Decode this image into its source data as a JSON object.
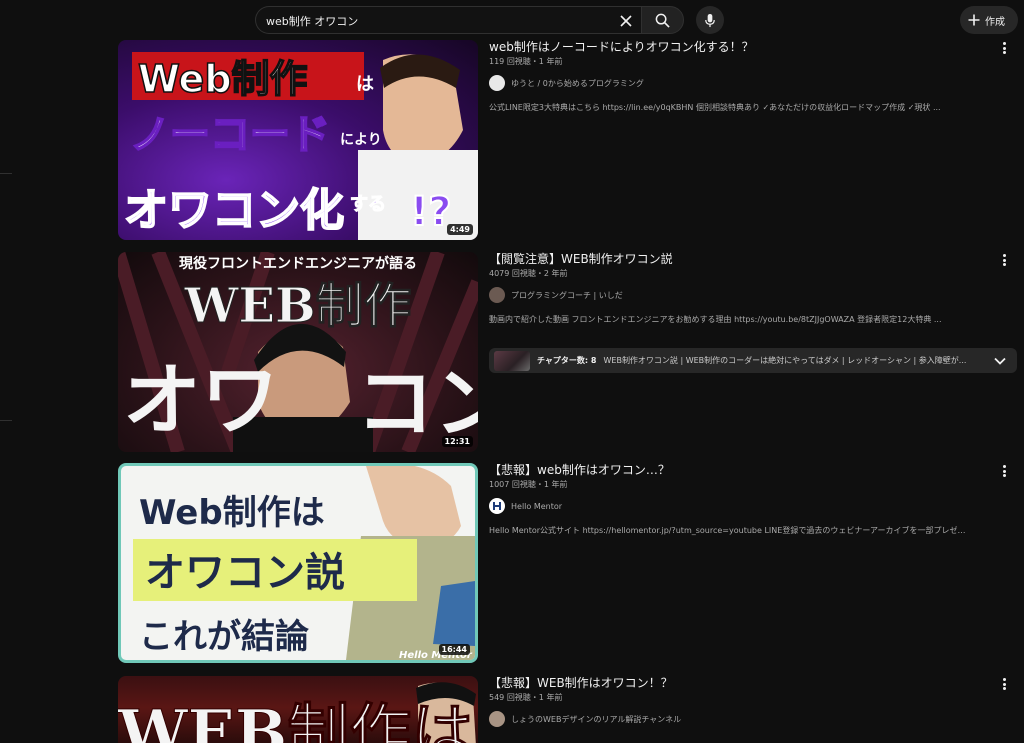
{
  "search": {
    "query": "web制作 オワコン"
  },
  "header": {
    "create_label": "作成"
  },
  "results": [
    {
      "title": "web制作はノーコードによりオワコン化する！？",
      "meta": "119 回視聴・1 年前",
      "channel": "ゆうと / 0から始めるプログラミング",
      "description": "公式LINE限定3大特典はこちら https://lin.ee/y0qKBHN 個別相談特典あり ✓あなただけの収益化ロードマップ作成 ✓現状 ...",
      "duration": "4:49",
      "thumb_text": [
        "Web制作",
        "は",
        "ノーコード",
        "により",
        "オワコン化",
        "する",
        "!?"
      ]
    },
    {
      "title": "【閲覧注意】WEB制作オワコン説",
      "meta": "4079 回視聴・2 年前",
      "channel": "プログラミングコーチ | いしだ",
      "description": "動画内で紹介した動画 フロントエンドエンジニアをお勧めする理由 https://youtu.be/8tZJJgOWAZA 登録者限定12大特典 ...",
      "duration": "12:31",
      "chapters_label": "チャプター数: 8",
      "chapters_text": "WEB制作オワコン説 | WEB制作のコーダーは絶対にやってはダメ | レッドオーシャン | 参入障壁が...",
      "thumb_text": [
        "現役フロントエンドエンジニアが語る",
        "WEB制作",
        "オワ",
        "コン"
      ]
    },
    {
      "title": "【悲報】web制作はオワコン…？",
      "meta": "1007 回視聴・1 年前",
      "channel": "Hello Mentor",
      "description": "Hello Mentor公式サイト https://hellomentor.jp/?utm_source=youtube LINE登録で過去のウェビナーアーカイブを一部プレゼント！",
      "duration": "16:44",
      "thumb_text": [
        "Web制作は",
        "オワコン説",
        "これが結論",
        "Hello Mentor"
      ]
    },
    {
      "title": "【悲報】WEB制作はオワコン！？",
      "meta": "549 回視聴・1 年前",
      "channel": "しょうのWEBデザインのリアル解説チャンネル",
      "thumb_text": [
        "WEB制作は"
      ]
    }
  ],
  "colors": {
    "background": "#0f0f0f",
    "chip": "#272727",
    "secondary_text": "#aaaaaa"
  }
}
